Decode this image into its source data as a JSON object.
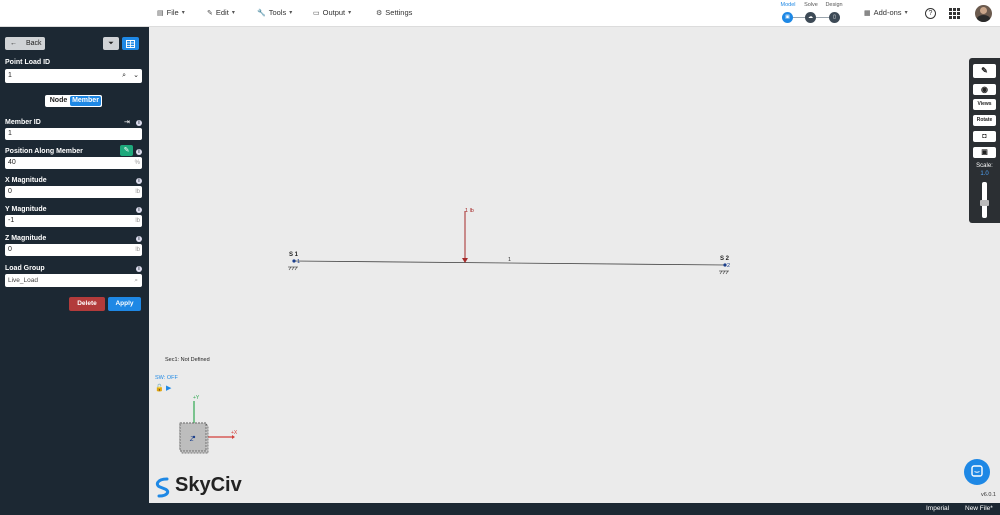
{
  "menu": {
    "file": "File",
    "edit": "Edit",
    "tools": "Tools",
    "output": "Output",
    "settings": "Settings",
    "addons": "Add-ons"
  },
  "workflow": {
    "model": "Model",
    "solve": "Solve",
    "design": "Design"
  },
  "sidebar": {
    "back": "Back",
    "point_load_id_label": "Point Load ID",
    "point_load_id_value": "1",
    "toggle_node": "Node",
    "toggle_member": "Member",
    "member_id_label": "Member ID",
    "member_id_value": "1",
    "position_label": "Position Along Member",
    "position_value": "40",
    "position_unit": "%",
    "x_label": "X Magnitude",
    "x_value": "0",
    "x_unit": "lb",
    "y_label": "Y Magnitude",
    "y_value": "-1",
    "y_unit": "lb",
    "z_label": "Z Magnitude",
    "z_value": "0",
    "z_unit": "lb",
    "load_group_label": "Load Group",
    "load_group_value": "Live_Load",
    "delete": "Delete",
    "apply": "Apply"
  },
  "canvas": {
    "load_label": "1 lb",
    "support1": "S 1",
    "node1": "1",
    "support2": "S 2",
    "node2": "2",
    "member_label": "1",
    "section_info": "Sec1: Not Defined",
    "sw_status": "SW: OFF",
    "axis_y": "+Y",
    "axis_x": "+X",
    "axis_z": "Z"
  },
  "right_toolbar": {
    "views": "Views",
    "rotate": "Rotate",
    "scale_label": "Scale:",
    "scale_value": "1.0"
  },
  "brand": "SkyCiv",
  "version": "v6.0.1",
  "status": {
    "units": "Imperial",
    "file": "New File*"
  },
  "colors": {
    "sidebar": "#1c2833",
    "accent": "#1e88e5",
    "delete": "#b23b3b",
    "load": "#a52a2a"
  }
}
